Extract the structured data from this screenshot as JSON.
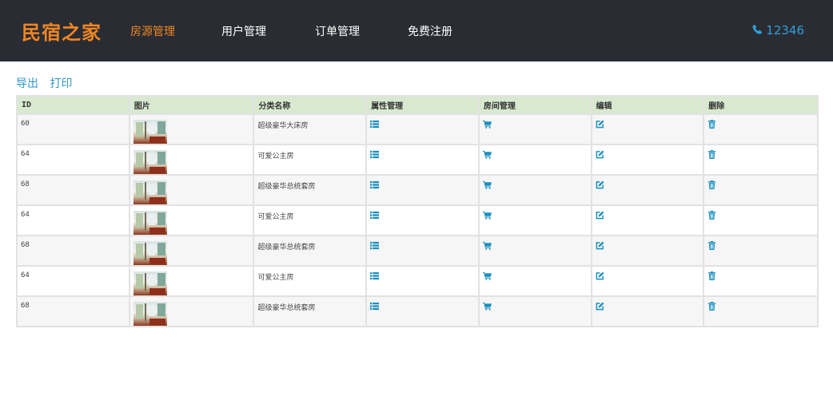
{
  "brand": "民宿之家",
  "nav": [
    {
      "label": "房源管理",
      "active": true
    },
    {
      "label": "用户管理",
      "active": false
    },
    {
      "label": "订单管理",
      "active": false
    },
    {
      "label": "免费注册",
      "active": false
    }
  ],
  "phone": {
    "icon": "phone-icon",
    "number": "12346"
  },
  "toolbar": {
    "export_label": "导出",
    "print_label": "打印"
  },
  "table": {
    "headers": [
      "ID",
      "图片",
      "分类名称",
      "属性管理",
      "房间管理",
      "编辑",
      "删除"
    ],
    "rows": [
      {
        "id": "60",
        "name": "超级豪华大床房"
      },
      {
        "id": "64",
        "name": "可爱公主房"
      },
      {
        "id": "68",
        "name": "超级豪华总统套房"
      },
      {
        "id": "64",
        "name": "可爱公主房"
      },
      {
        "id": "68",
        "name": "超级豪华总统套房"
      },
      {
        "id": "64",
        "name": "可爱公主房"
      },
      {
        "id": "68",
        "name": "超级豪华总统套房"
      }
    ]
  },
  "icons": {
    "attributes": "list-icon",
    "rooms": "cart-icon",
    "edit": "edit-icon",
    "delete": "trash-icon"
  },
  "colors": {
    "brand": "#f08624",
    "navbar": "#2a2c33",
    "link": "#2e98c8",
    "header_row": "#d8e9d0",
    "icon": "#1b8fc0"
  }
}
